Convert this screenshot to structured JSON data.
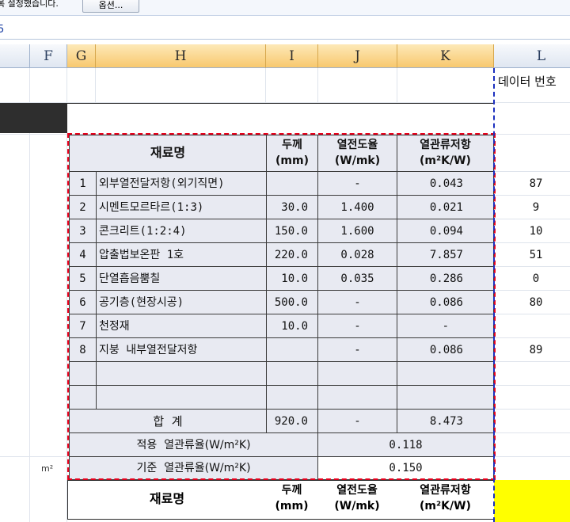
{
  "message_bar": {
    "text": "록 설정했습니다.",
    "options_button": "옵션..."
  },
  "formula_bar": {
    "fragment": "5"
  },
  "columns": [
    "F",
    "G",
    "H",
    "I",
    "J",
    "K",
    "L"
  ],
  "unit_label": "m²",
  "l_header": "데이터 번호",
  "table": {
    "headers": {
      "material": "재료명",
      "thickness_1": "두께",
      "thickness_2": "(mm)",
      "conductivity_1": "열전도율",
      "conductivity_2": "(W/mk)",
      "resistance_1": "열관류저항",
      "resistance_2": "(m²K/W)"
    },
    "rows": [
      {
        "no": "1",
        "name": "외부열전달저항(외기직면)",
        "thick": "",
        "cond": "-",
        "res": "0.043",
        "code": "87"
      },
      {
        "no": "2",
        "name": "시멘트모르타르(1:3)",
        "thick": "30.0",
        "cond": "1.400",
        "res": "0.021",
        "code": "9"
      },
      {
        "no": "3",
        "name": "콘크리트(1:2:4)",
        "thick": "150.0",
        "cond": "1.600",
        "res": "0.094",
        "code": "10"
      },
      {
        "no": "4",
        "name": "압출법보온판 1호",
        "thick": "220.0",
        "cond": "0.028",
        "res": "7.857",
        "code": "51"
      },
      {
        "no": "5",
        "name": "단열흡음뿜칠",
        "thick": "10.0",
        "cond": "0.035",
        "res": "0.286",
        "code": "0"
      },
      {
        "no": "6",
        "name": "공기층(현장시공)",
        "thick": "500.0",
        "cond": "-",
        "res": "0.086",
        "code": "80"
      },
      {
        "no": "7",
        "name": "천정재",
        "thick": "10.0",
        "cond": "-",
        "res": "-",
        "code": ""
      },
      {
        "no": "8",
        "name": "지붕 내부열전달저항",
        "thick": "",
        "cond": "-",
        "res": "0.086",
        "code": "89"
      },
      {
        "no": "",
        "name": "",
        "thick": "",
        "cond": "",
        "res": "",
        "code": ""
      },
      {
        "no": "",
        "name": "",
        "thick": "",
        "cond": "",
        "res": "",
        "code": ""
      }
    ],
    "total": {
      "label": "합  계",
      "thick": "920.0",
      "cond": "-",
      "res": "8.473"
    },
    "applied": {
      "label": "적용  열관류율(W/m²K)",
      "value": "0.118"
    },
    "standard": {
      "label": "기준  열관류율(W/m²K)",
      "value": "0.150"
    }
  },
  "colors": {
    "selection_border": "#e8001c",
    "dark_cell": "#2e2e2e",
    "yellow_cell": "#ffff00",
    "page_break": "#1b2fbf"
  }
}
